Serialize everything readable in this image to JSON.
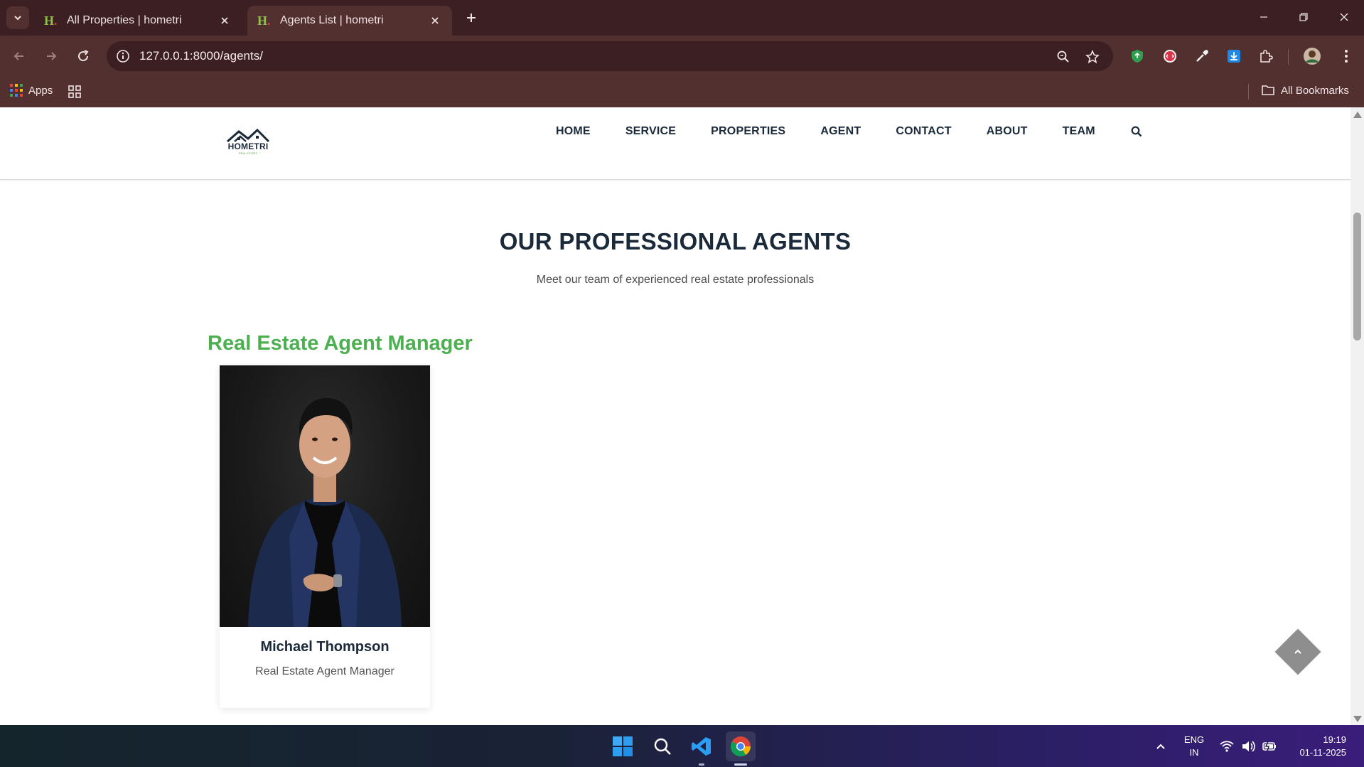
{
  "browser": {
    "tabs": [
      {
        "title": "All Properties | hometri",
        "active": false
      },
      {
        "title": "Agents List | hometri",
        "active": true
      }
    ],
    "url": "127.0.0.1:8000/agents/",
    "bookmarks": {
      "apps_label": "Apps",
      "all_bookmarks_label": "All Bookmarks"
    },
    "theme": {
      "frame": "#3c1f22",
      "toolbar": "#52302f"
    }
  },
  "site": {
    "logo": {
      "name": "HOMETRI",
      "tagline": "REAL ESTATE"
    },
    "nav": [
      "HOME",
      "SERVICE",
      "PROPERTIES",
      "AGENT",
      "CONTACT",
      "ABOUT",
      "TEAM"
    ],
    "search_icon": "search-icon"
  },
  "page": {
    "title": "OUR PROFESSIONAL AGENTS",
    "subtitle": "Meet our team of experienced real estate professionals",
    "groups": [
      {
        "title": "Real Estate Agent Manager",
        "agents": [
          {
            "name": "Michael Thompson",
            "role": "Real Estate Agent Manager"
          }
        ]
      }
    ],
    "colors": {
      "accent": "#4caf50",
      "heading": "#1b2a3a"
    }
  },
  "taskbar": {
    "lang_line1": "ENG",
    "lang_line2": "IN",
    "time": "19:19",
    "date": "01-11-2025"
  }
}
